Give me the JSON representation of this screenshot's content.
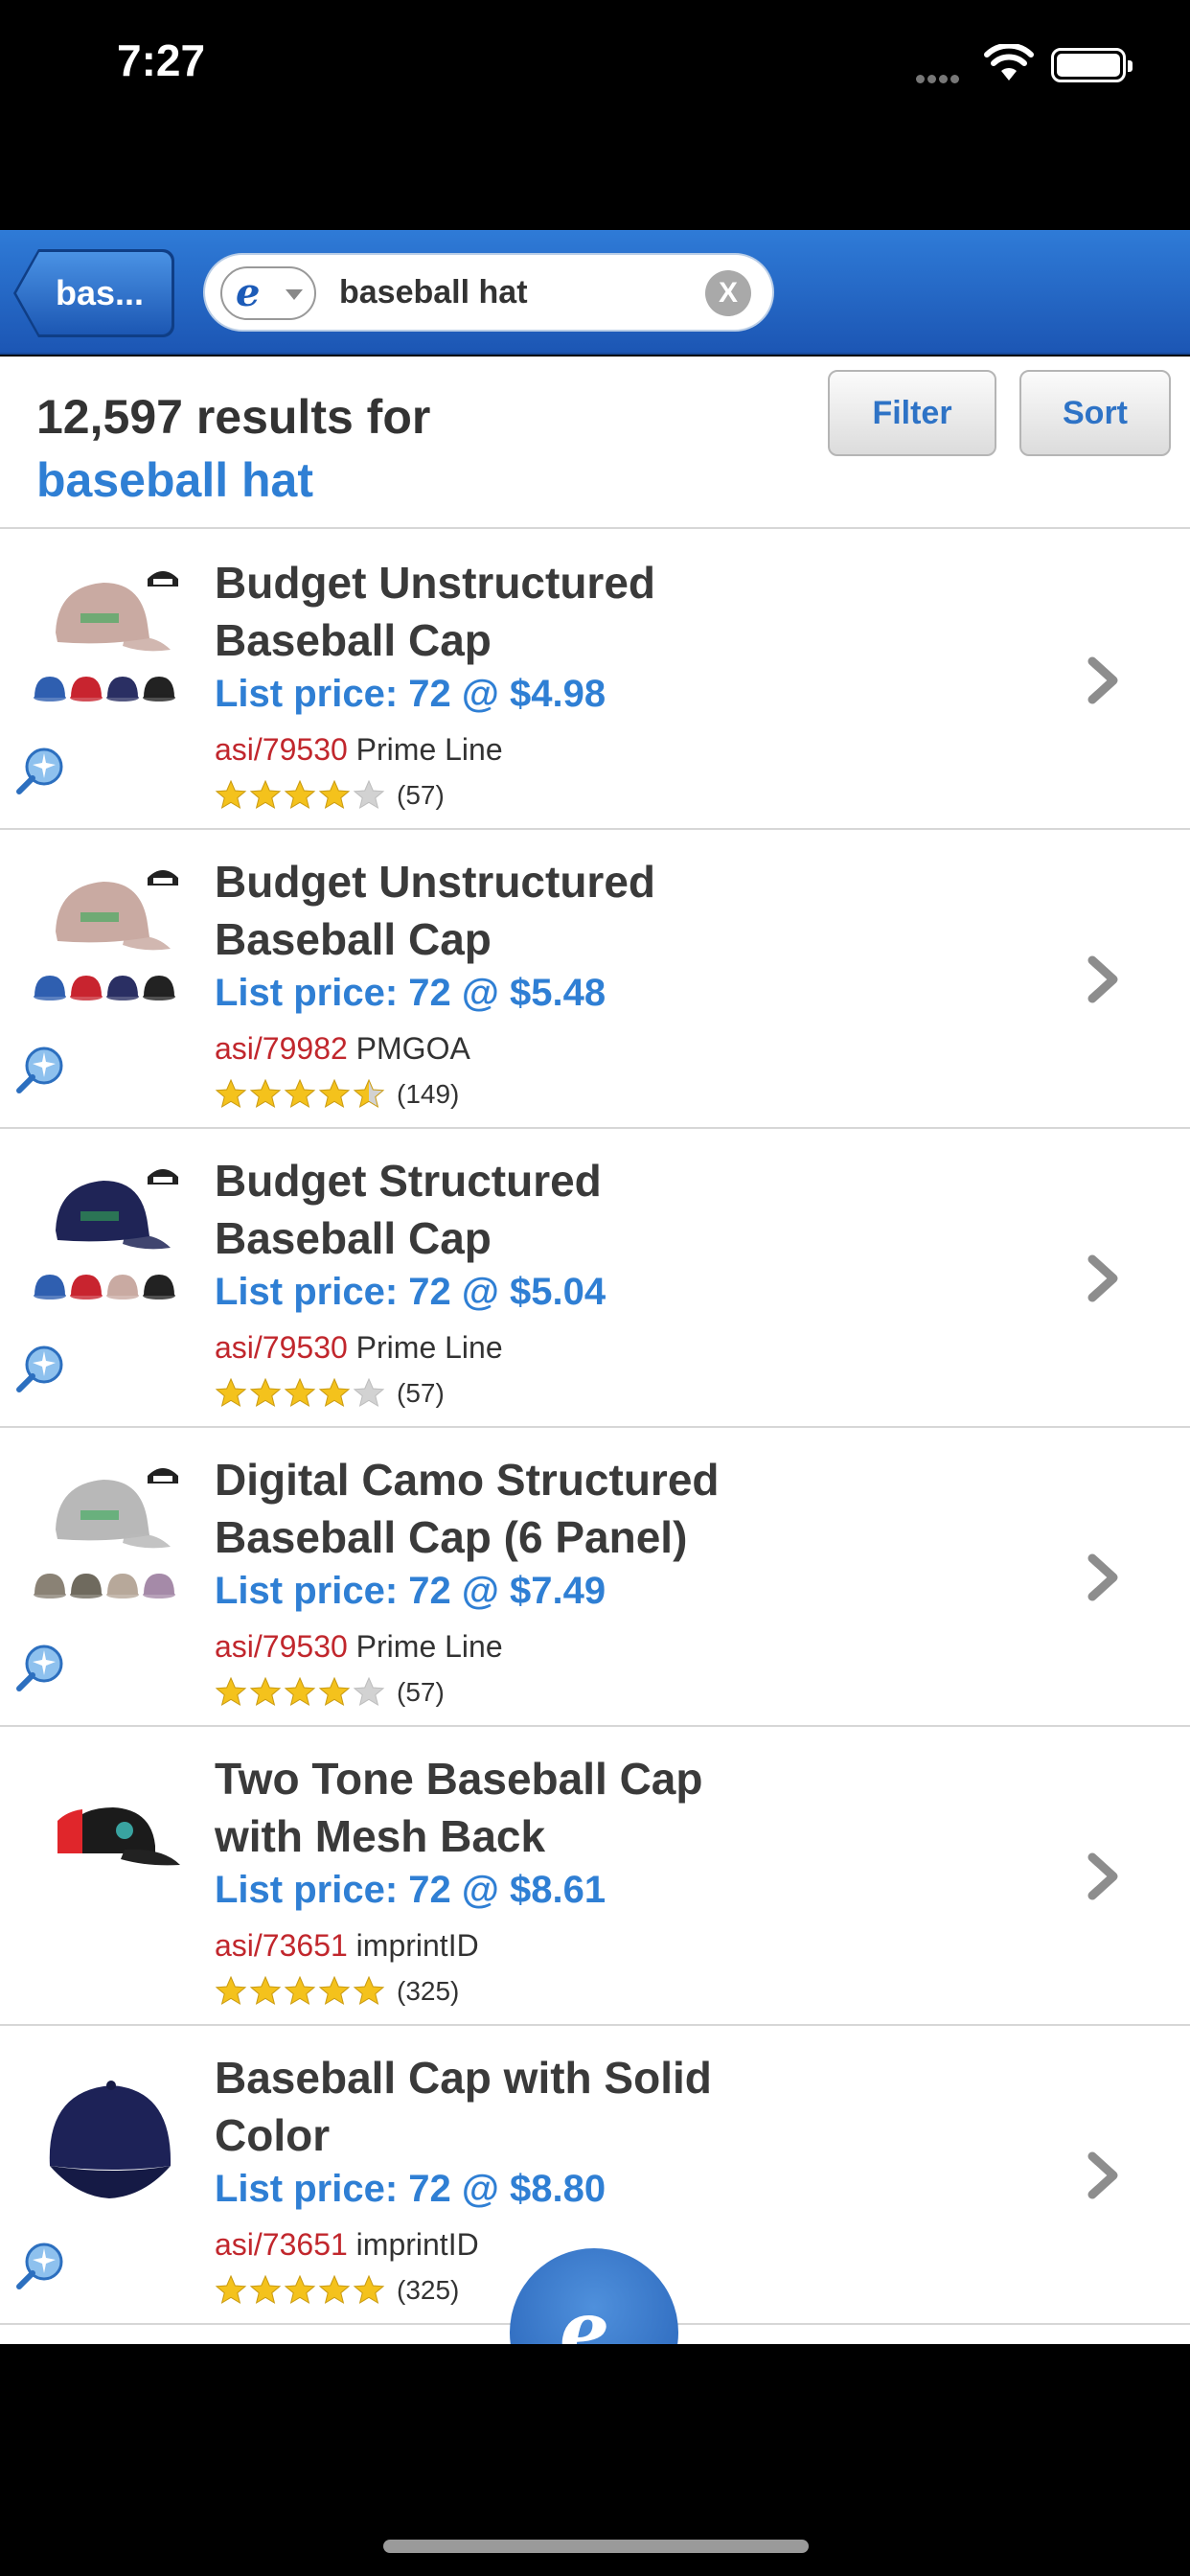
{
  "status_bar": {
    "time": "7:27"
  },
  "header": {
    "back_label": "bas...",
    "search_query": "baseball hat",
    "clear_label": "X"
  },
  "results": {
    "count_text": "12,597 results for",
    "query_text": "baseball hat",
    "filter_label": "Filter",
    "sort_label": "Sort"
  },
  "products": [
    {
      "title_line1": "Budget Unstructured",
      "title_line2": "Baseball Cap",
      "price": "List price: 72 @ $4.98",
      "asi": "asi/79530",
      "supplier": "Prime Line",
      "rating": 4,
      "reviews": "(57)",
      "hat_color": "#c9aaa2",
      "variant_colors": [
        "#2f5fb0",
        "#c8242f",
        "#2a2f63",
        "#222"
      ]
    },
    {
      "title_line1": "Budget Unstructured",
      "title_line2": "Baseball Cap",
      "price": "List price: 72 @ $5.48",
      "asi": "asi/79982",
      "supplier": "PMGOA",
      "rating": 4.5,
      "reviews": "(149)",
      "hat_color": "#c9aaa2",
      "variant_colors": [
        "#2f5fb0",
        "#c8242f",
        "#2a2f63",
        "#222"
      ]
    },
    {
      "title_line1": "Budget Structured",
      "title_line2": "Baseball Cap",
      "price": "List price: 72 @ $5.04",
      "asi": "asi/79530",
      "supplier": "Prime Line",
      "rating": 4,
      "reviews": "(57)",
      "hat_color": "#1f2456",
      "variant_colors": [
        "#2f5fb0",
        "#c8242f",
        "#c9aaa2",
        "#222"
      ]
    },
    {
      "title_line1": "Digital Camo Structured",
      "title_line2": "Baseball Cap (6 Panel)",
      "price": "List price: 72 @ $7.49",
      "asi": "asi/79530",
      "supplier": "Prime Line",
      "rating": 4,
      "reviews": "(57)",
      "hat_color": "#b8b8b8",
      "variant_colors": [
        "#8a8275",
        "#6f6a5e",
        "#b7a89a",
        "#a58aa8"
      ]
    },
    {
      "title_line1": "Two Tone Baseball Cap",
      "title_line2": "with Mesh Back",
      "price": "List price: 72 @ $8.61",
      "asi": "asi/73651",
      "supplier": "imprintID",
      "rating": 5,
      "reviews": "(325)",
      "hat_color": "#1b1b1b",
      "variant_colors": []
    },
    {
      "title_line1": "Baseball Cap with Solid",
      "title_line2": "Color",
      "price": "List price: 72 @ $8.80",
      "asi": "asi/73651",
      "supplier": "imprintID",
      "rating": 5,
      "reviews": "(325)",
      "hat_color": "#1d2257",
      "variant_colors": []
    }
  ],
  "colors": {
    "accent": "#2f7fd4",
    "header_blue": "#1c56b4",
    "asi_red": "#c1272d",
    "star": "#f4c21c"
  }
}
